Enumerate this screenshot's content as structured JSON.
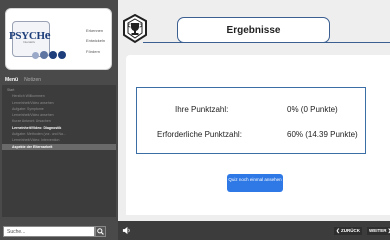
{
  "logo": {
    "brand": "PSYCH",
    "brand_mark": "e",
    "subtitle": "Interaktiv",
    "tagline": [
      "Erkennen",
      "Entwickeln",
      "Fördern"
    ]
  },
  "sidebar": {
    "tabs": [
      {
        "label": "Menü",
        "active": true
      },
      {
        "label": "Notizen",
        "active": false
      }
    ],
    "items": [
      {
        "label": "Start",
        "state": "root"
      },
      {
        "label": "Herzlich Willkommen",
        "state": "normal"
      },
      {
        "label": "Lerneinheit/Video ansehen",
        "state": "normal"
      },
      {
        "label": "Aufgabe: Symptome",
        "state": "normal"
      },
      {
        "label": "Lerneinheit/Video ansehen",
        "state": "normal"
      },
      {
        "label": "Kurze Antwort: Ursachen",
        "state": "normal"
      },
      {
        "label": "Lerneinheit/Video: Diagnostik",
        "state": "current"
      },
      {
        "label": "Aufgabe: Methoden (vor- und Na...",
        "state": "normal"
      },
      {
        "label": "Lerneinheit/Video: Intervention",
        "state": "normal"
      },
      {
        "label": "Aspekte der Elternarbeit",
        "state": "highlighted"
      }
    ],
    "search": {
      "value": "Suche..."
    },
    "search_icon": "search-icon"
  },
  "header": {
    "title": "Ergebnisse",
    "badge_icon": "trophy-badge-icon"
  },
  "results": {
    "score_label": "Ihre Punktzahl:",
    "score_value": "0% (0 Punkte)",
    "required_label": "Erforderliche Punktzahl:",
    "required_value": "60% (14.39 Punkte)"
  },
  "retry_button": {
    "label": "Quiz noch einmal ansehen"
  },
  "footer": {
    "speaker_icon": "speaker-icon",
    "back_label": "❮ ZURÜCK",
    "next_label": "WEITER ❯"
  },
  "colors": {
    "sidebar_bg": "#4a4a4a",
    "accent_blue": "#3b5f91",
    "button_blue": "#2f79e6",
    "highlight": "#6a6a6a"
  }
}
